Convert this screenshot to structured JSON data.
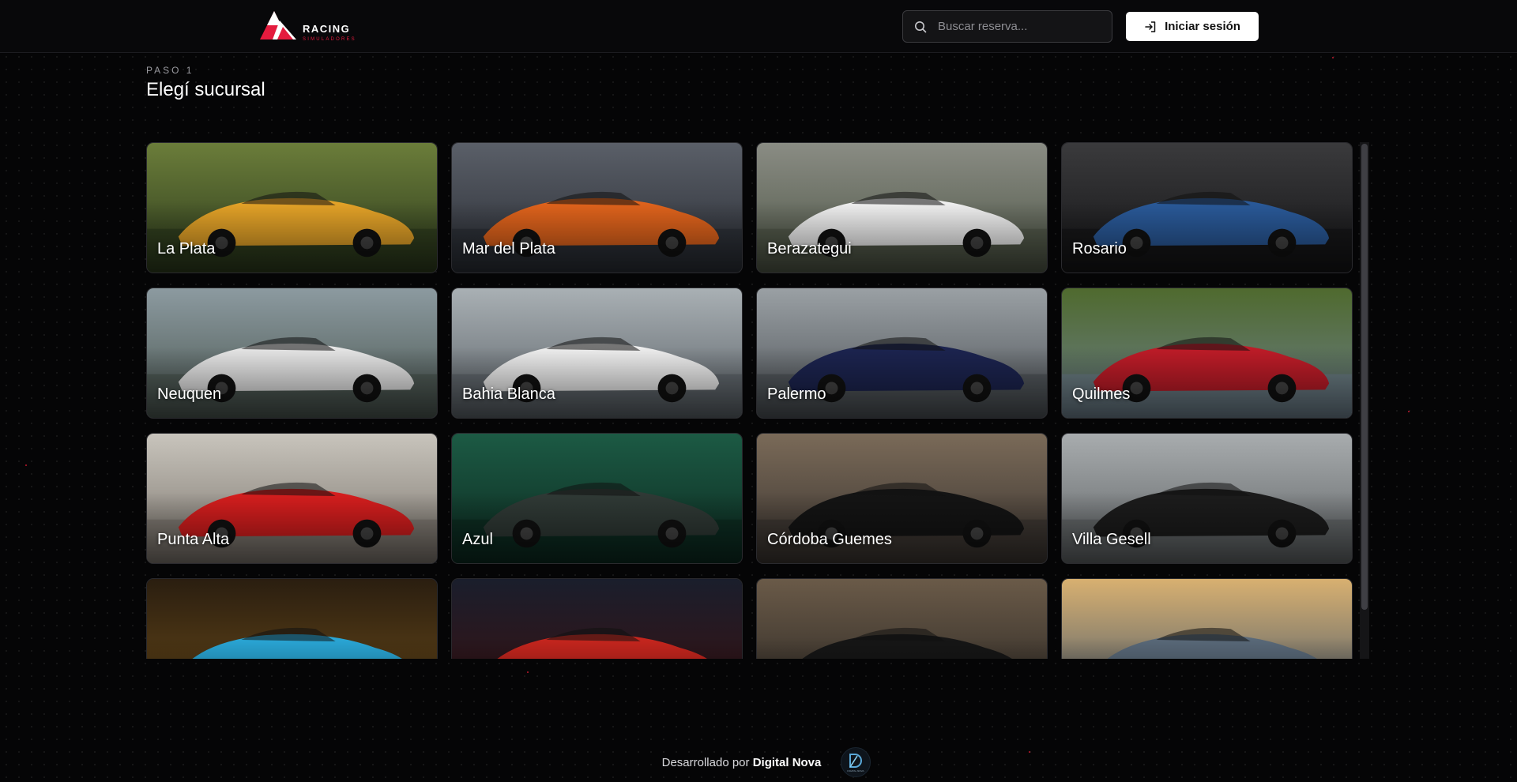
{
  "header": {
    "logo_text": "RACING",
    "logo_sub": "SIMULADORES",
    "search": {
      "placeholder": "Buscar reserva...",
      "value": ""
    },
    "login_label": "Iniciar sesión"
  },
  "step": {
    "label": "PASO 1",
    "title": "Elegí sucursal"
  },
  "colors": {
    "accent": "#e41b3e",
    "background": "#050506",
    "card_border": "#2a2a2e"
  },
  "branches": [
    {
      "name": "La Plata",
      "theme": [
        "#6b7d3a",
        "#2c3a1c",
        "#e6a428"
      ]
    },
    {
      "name": "Mar del Plata",
      "theme": [
        "#5a5f68",
        "#2a2d34",
        "#e2641c"
      ]
    },
    {
      "name": "Berazategui",
      "theme": [
        "#8a8c84",
        "#4e5646",
        "#f2f2f2"
      ]
    },
    {
      "name": "Rosario",
      "theme": [
        "#3a3a3c",
        "#141416",
        "#2a5a9a"
      ]
    },
    {
      "name": "Neuquen",
      "theme": [
        "#8c9aa0",
        "#4a5650",
        "#e8e8e8"
      ]
    },
    {
      "name": "Bahia Blanca",
      "theme": [
        "#a9b0b4",
        "#5b6268",
        "#f0f0f0"
      ]
    },
    {
      "name": "Palermo",
      "theme": [
        "#9aa0a4",
        "#4c5156",
        "#1c2450"
      ]
    },
    {
      "name": "Quilmes",
      "theme": [
        "#4f6a2e",
        "#6c7e8a",
        "#c01c28"
      ]
    },
    {
      "name": "Punta Alta",
      "theme": [
        "#c8c4bc",
        "#7a746c",
        "#d81e1e"
      ]
    },
    {
      "name": "Azul",
      "theme": [
        "#1c5a44",
        "#0c2a20",
        "#303a36"
      ]
    },
    {
      "name": "Córdoba Guemes",
      "theme": [
        "#7a6a58",
        "#3a3430",
        "#141414"
      ]
    },
    {
      "name": "Villa Gesell",
      "theme": [
        "#a8acae",
        "#5e6264",
        "#1c1c1c"
      ]
    },
    {
      "name": "",
      "theme": [
        "#2a1e10",
        "#6a4a18",
        "#2aa8d8"
      ]
    },
    {
      "name": "",
      "theme": [
        "#1a1e2c",
        "#3a1010",
        "#c8261e"
      ]
    },
    {
      "name": "",
      "theme": [
        "#6a5a48",
        "#2c2824",
        "#161616"
      ]
    },
    {
      "name": "",
      "theme": [
        "#d8b070",
        "#4a5a6c",
        "#5a6a7a"
      ]
    }
  ],
  "footer": {
    "prefix": "Desarrollado por",
    "brand": "Digital Nova",
    "logo_caption": "DIGITAL NOVA"
  }
}
